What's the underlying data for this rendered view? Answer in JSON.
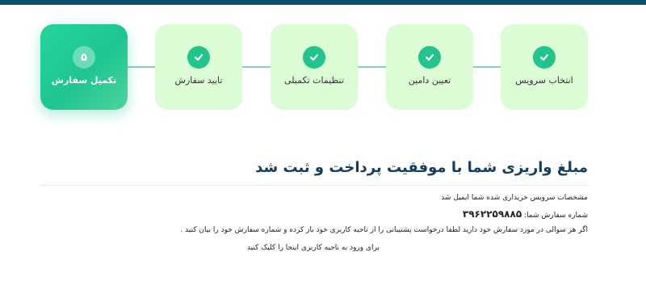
{
  "stepper": {
    "steps": [
      {
        "label": "انتخاب سرویس",
        "status": "done",
        "icon": "check-icon"
      },
      {
        "label": "تعیین دامین",
        "status": "done",
        "icon": "check-icon"
      },
      {
        "label": "تنظیمات تکمیلی",
        "status": "done",
        "icon": "check-icon"
      },
      {
        "label": "تایید سفارش",
        "status": "done",
        "icon": "check-icon"
      },
      {
        "label": "تکمیل سفارش",
        "status": "active",
        "number": "۵"
      }
    ]
  },
  "result": {
    "heading": "مبلغ واریزی شما با موفقیت پرداخت و ثبت شد",
    "emailed_text": "مشخصات سرویس خریداری شده شما ایمیل شد",
    "order_number_label": "شماره سفارش شما:",
    "order_number": "۳۹۶۲۲۵۹۸۸۵",
    "support_text": "اگر هر سوالی در مورد سفارش خود دارید لطفا درخواست پشتیبانی را از ناحیه کاربری خود باز کرده و شماره سفارش خود را بیان کنید .",
    "login_link_text": "برای ورود به ناحیه کاربری اینجا را کلیک کنید"
  },
  "colors": {
    "accent": "#21c48a",
    "step_bg": "#dcfcd6",
    "heading": "#143d5e",
    "topbar": "#0d4d6e"
  }
}
